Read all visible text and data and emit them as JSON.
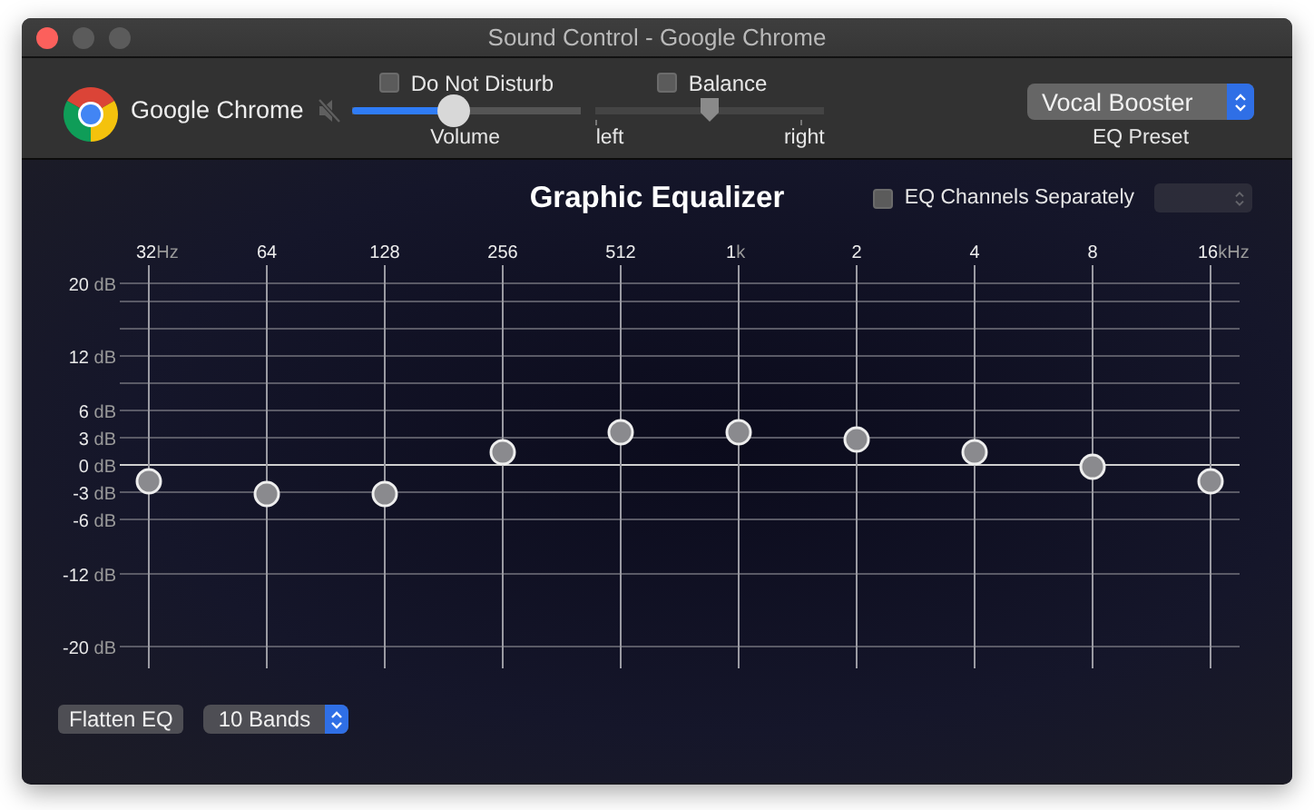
{
  "window": {
    "title": "Sound Control - Google Chrome"
  },
  "app": {
    "name": "Google Chrome",
    "muted": true
  },
  "do_not_disturb": {
    "label": "Do Not Disturb",
    "checked": false
  },
  "volume": {
    "label": "Volume",
    "level": 0.44
  },
  "balance": {
    "label": "Balance",
    "checked": false,
    "level": 0.5,
    "left_label": "left",
    "right_label": "right"
  },
  "eq_preset": {
    "value": "Vocal Booster",
    "label": "EQ Preset"
  },
  "equalizer": {
    "title": "Graphic Equalizer",
    "channels_separately": {
      "label": "EQ Channels Separately",
      "checked": false
    },
    "channel_menu": {
      "disabled": true
    },
    "y_axis": [
      {
        "value": "20",
        "unit": "dB"
      },
      {
        "value": "12",
        "unit": "dB"
      },
      {
        "value": "6",
        "unit": "dB"
      },
      {
        "value": "3",
        "unit": "dB"
      },
      {
        "value": "0",
        "unit": "dB"
      },
      {
        "value": "-3",
        "unit": "dB"
      },
      {
        "value": "-6",
        "unit": "dB"
      },
      {
        "value": "-12",
        "unit": "dB"
      },
      {
        "value": "-20",
        "unit": "dB"
      }
    ],
    "bands": [
      {
        "value": "32",
        "unit": "Hz",
        "level": 0.455
      },
      {
        "value": "64",
        "level": 0.42
      },
      {
        "value": "128",
        "level": 0.42
      },
      {
        "value": "256",
        "level": 0.535
      },
      {
        "value": "512",
        "level": 0.59
      },
      {
        "value": "1",
        "unit": "k",
        "level": 0.59
      },
      {
        "value": "2",
        "level": 0.57
      },
      {
        "value": "4",
        "level": 0.535
      },
      {
        "value": "8",
        "level": 0.495
      },
      {
        "value": "16",
        "unit": "kHz",
        "level": 0.455
      }
    ]
  },
  "flatten_button": {
    "label": "Flatten EQ"
  },
  "bands_menu": {
    "value": "10 Bands"
  }
}
